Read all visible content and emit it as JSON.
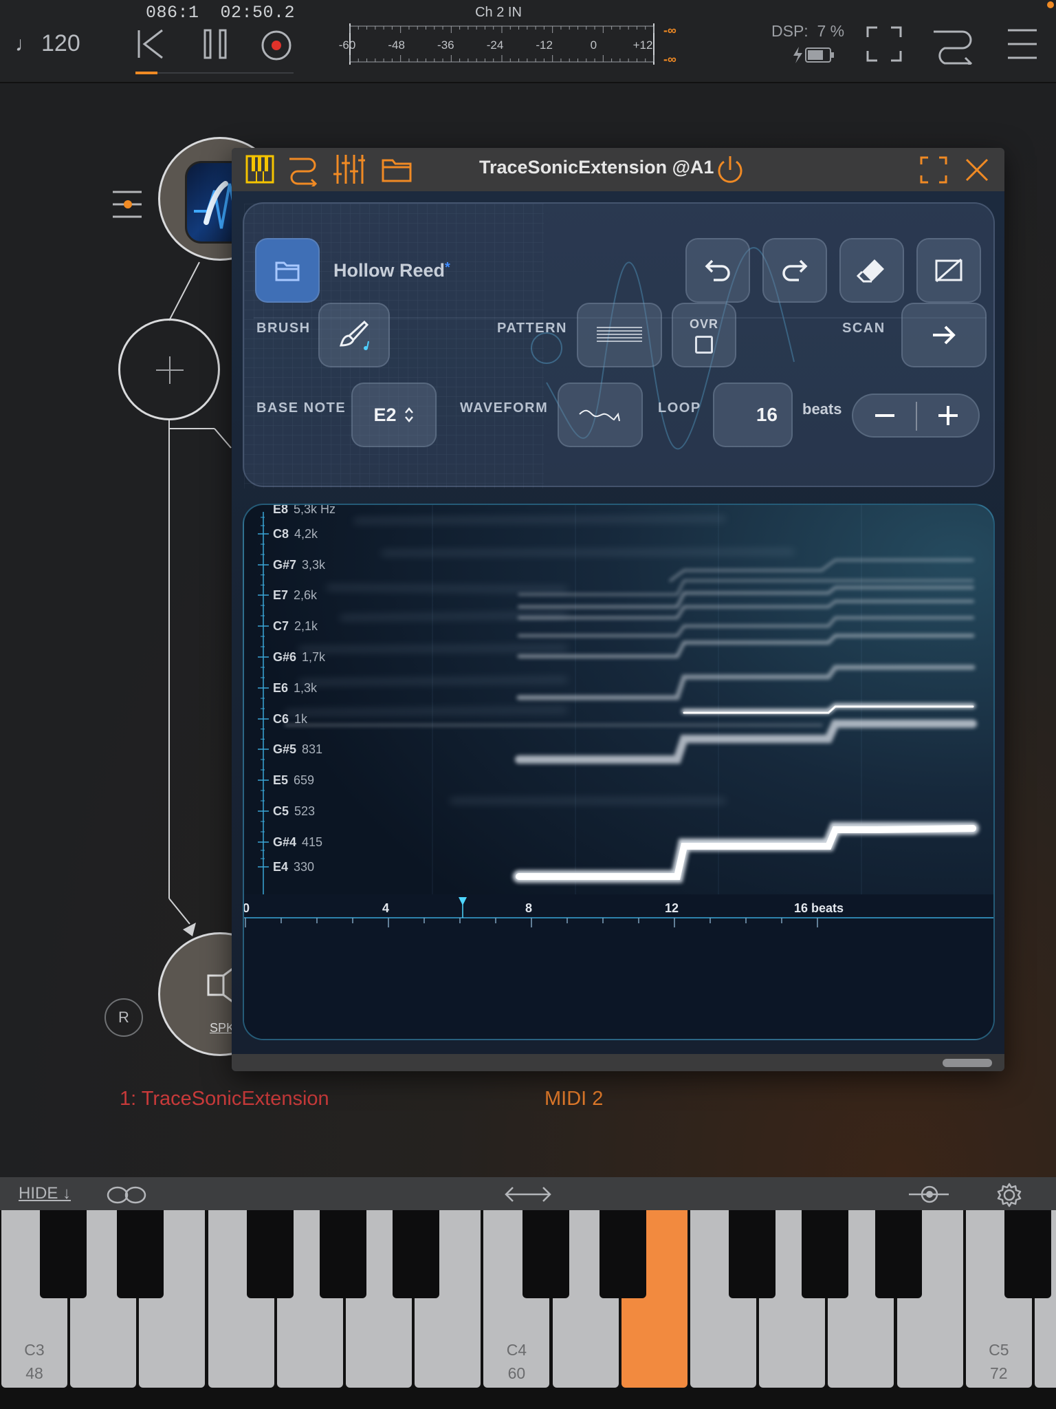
{
  "transport": {
    "tempo": "120",
    "position_bars": "086:1",
    "position_time": "02:50.2",
    "playhead_progress": 0.14
  },
  "meter": {
    "title": "Ch 2 IN",
    "scale": [
      "-60",
      "-48",
      "-36",
      "-24",
      "-12",
      "0",
      "+12"
    ],
    "peak_top": "-∞",
    "peak_bottom": "-∞"
  },
  "dsp": {
    "label": "DSP:",
    "value": "7 %"
  },
  "workspace": {
    "track_name": "1: TraceSonicExtension",
    "midi_label": "MIDI 2",
    "record_label": "R",
    "speaker_label": "SPK"
  },
  "plugin": {
    "title": "TraceSonicExtension @A1",
    "preset_name": "Hollow Reed",
    "preset_modified": "*",
    "brush_label": "BRUSH",
    "pattern_label": "PATTERN",
    "ovr_label": "OVR",
    "scan_label": "SCAN",
    "base_note_label": "BASE NOTE",
    "base_note_value": "E2",
    "waveform_label": "WAVEFORM",
    "loop_label": "LOOP",
    "loop_value": "16",
    "loop_unit": "beats"
  },
  "spectrogram": {
    "freq_rows": [
      {
        "note": "E8",
        "hz": "5,3k Hz"
      },
      {
        "note": "C8",
        "hz": "4,2k"
      },
      {
        "note": "G#7",
        "hz": "3,3k"
      },
      {
        "note": "E7",
        "hz": "2,6k"
      },
      {
        "note": "C7",
        "hz": "2,1k"
      },
      {
        "note": "G#6",
        "hz": "1,7k"
      },
      {
        "note": "E6",
        "hz": "1,3k"
      },
      {
        "note": "C6",
        "hz": "1k"
      },
      {
        "note": "G#5",
        "hz": "831"
      },
      {
        "note": "E5",
        "hz": "659"
      },
      {
        "note": "C5",
        "hz": "523"
      },
      {
        "note": "G#4",
        "hz": "415"
      },
      {
        "note": "E4",
        "hz": "330"
      }
    ],
    "beat_labels": [
      "0",
      "4",
      "8",
      "12",
      "16 beats"
    ]
  },
  "keyboard": {
    "hide_label": "HIDE ↓",
    "labels": [
      {
        "note": "C3",
        "num": "48"
      },
      {
        "note": "C4",
        "num": "60"
      },
      {
        "note": "C5",
        "num": "72"
      }
    ],
    "active_key_color": "#f28a3f"
  },
  "colors": {
    "accent": "#f08a24",
    "plugin_icon_yellow": "#f5c400",
    "track_red": "#c83a3a"
  }
}
